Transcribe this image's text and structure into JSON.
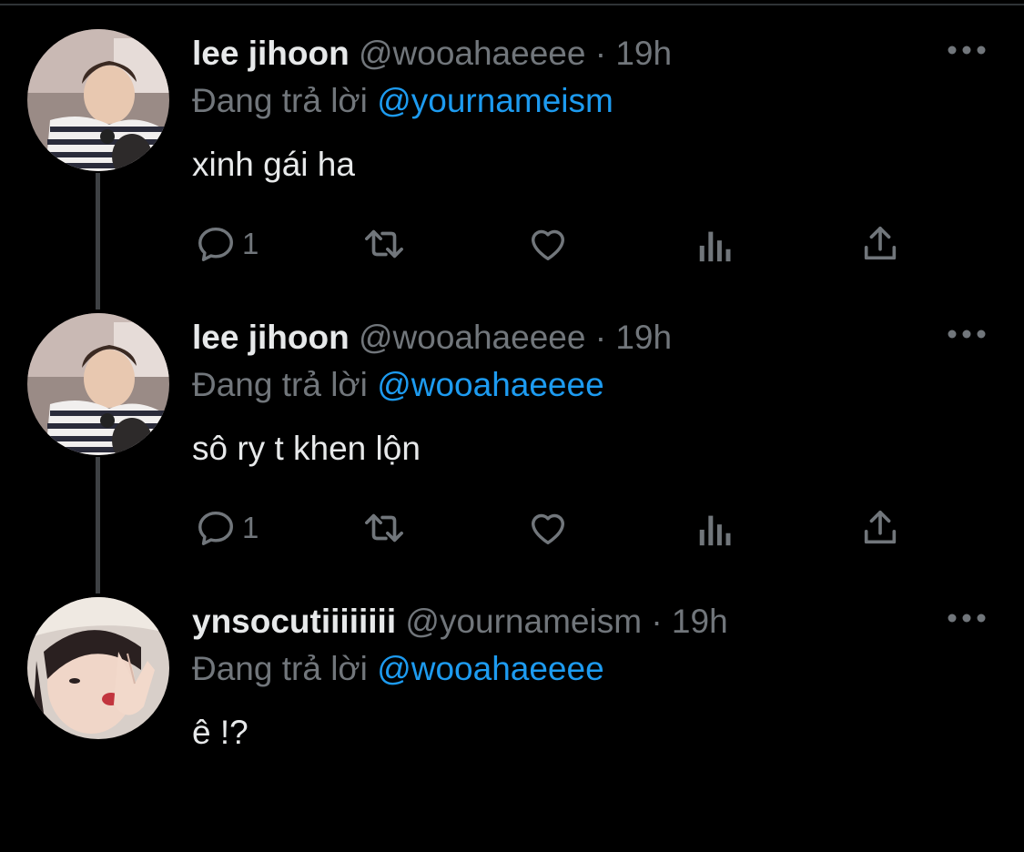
{
  "colors": {
    "background": "#000000",
    "name": "#e7e9ea",
    "secondary": "#71767b",
    "mention": "#1d9bf0",
    "thread_line": "#3e4144"
  },
  "labels": {
    "replying_prefix": "Đang trả lời",
    "dot": "·"
  },
  "tweets": [
    {
      "name": "lee jihoon",
      "handle": "@wooahaeeee",
      "time": "19h",
      "reply_to": "@yournameism",
      "text": "xinh gái ha",
      "reply_count": "1",
      "avatar": "lee-jihoon-avatar"
    },
    {
      "name": "lee jihoon",
      "handle": "@wooahaeeee",
      "time": "19h",
      "reply_to": "@wooahaeeee",
      "text": "sô ry t khen lộn",
      "reply_count": "1",
      "avatar": "lee-jihoon-avatar"
    },
    {
      "name": "ynsocutiiiiiiii",
      "handle": "@yournameism",
      "time": "19h",
      "reply_to": "@wooahaeeee",
      "text": "ê !?",
      "avatar": "ynsocutiiiiiiii-avatar"
    }
  ],
  "icons": {
    "reply": "reply-icon",
    "retweet": "retweet-icon",
    "like": "heart-icon",
    "views": "views-icon",
    "share": "share-icon",
    "more": "more-icon"
  }
}
